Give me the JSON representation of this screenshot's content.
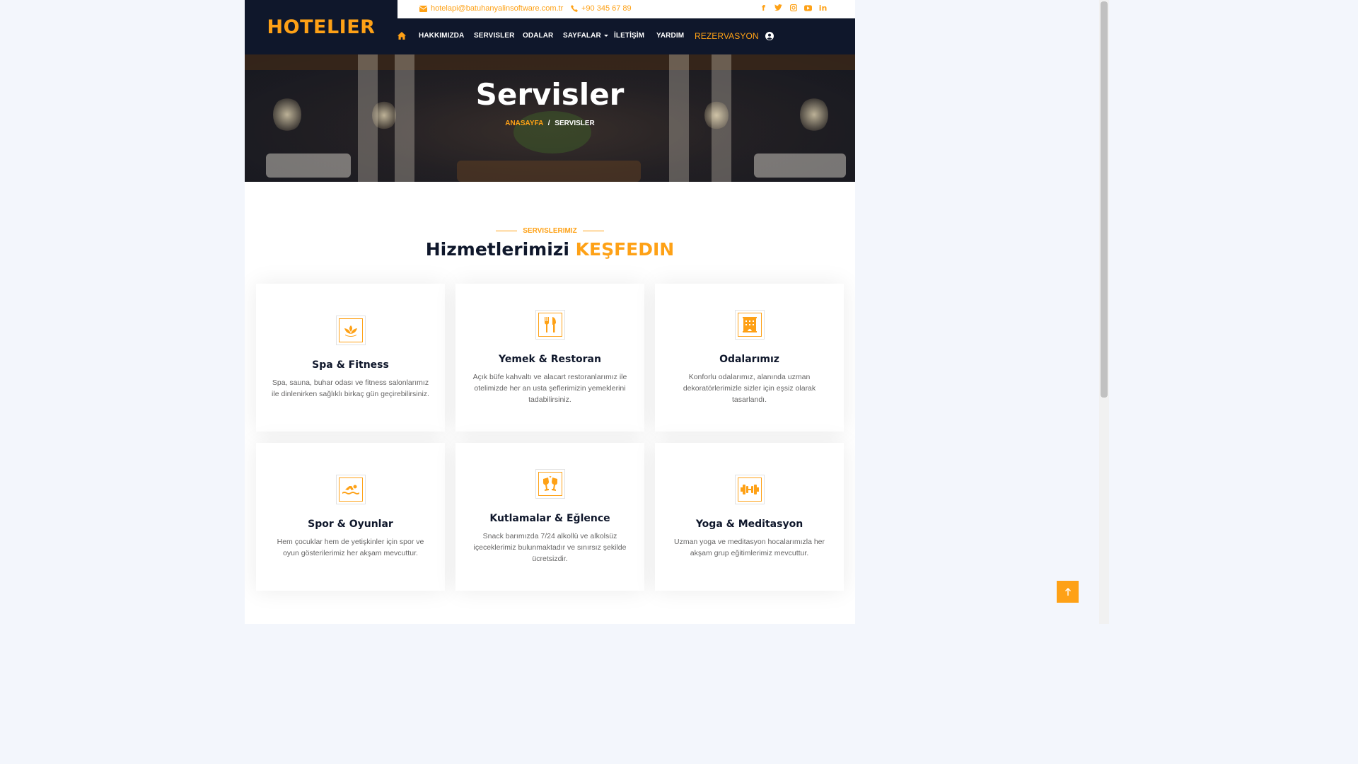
{
  "brand": {
    "name": "HOTELIER"
  },
  "topbar": {
    "email": "hotelapi@batuhanyalinsoftware.com.tr",
    "phone": "+90 345 67 89",
    "socials": [
      "facebook-icon",
      "twitter-icon",
      "instagram-icon",
      "youtube-icon",
      "linkedin-icon"
    ]
  },
  "nav": {
    "items": [
      "HAKKIMIZDA",
      "SERVISLER",
      "ODALAR",
      "SAYFALAR",
      "İLETİŞİM",
      "YARDIM"
    ],
    "cta": "REZERVASYON"
  },
  "hero": {
    "title": "Servisler",
    "breadcrumb_home": "ANASAYFA",
    "breadcrumb_sep": "/",
    "breadcrumb_current": "SERVISLER"
  },
  "section": {
    "eyebrow": "SERVISLERIMIZ",
    "title_main": "Hizmetlerimizi",
    "title_highlight": "KEŞFEDIN"
  },
  "services": [
    {
      "icon": "spa-icon",
      "title": "Spa & Fitness",
      "text": "Spa, sauna, buhar odası ve fitness salonlarımız ile dinlenirken sağlıklı birkaç gün geçirebilirsiniz."
    },
    {
      "icon": "utensils-icon",
      "title": "Yemek & Restoran",
      "text": "Açık büfe kahvaltı ve alacart restoranlarımız ile otelimizde her an usta şeflerimizin yemeklerini tadabilirsiniz."
    },
    {
      "icon": "hotel-icon",
      "title": "Odalarımız",
      "text": "Konforlu odalarımız, alanında uzman dekoratörlerimizle sizler için eşsiz olarak tasarlandı."
    },
    {
      "icon": "swimmer-icon",
      "title": "Spor & Oyunlar",
      "text": "Hem çocuklar hem de yetişkinler için spor ve oyun gösterilerimiz her akşam mevcuttur."
    },
    {
      "icon": "glass-cheers-icon",
      "title": "Kutlamalar & Eğlence",
      "text": "Snack barımızda 7/24 alkollü ve alkolsüz içeceklerimiz bulunmaktadır ve sınırsız şekilde ücretsizdir."
    },
    {
      "icon": "dumbbell-icon",
      "title": "Yoga & Meditasyon",
      "text": "Uzman yoga ve meditasyon hocalarımızla her akşam grup eğitimlerimiz mevcuttur."
    }
  ],
  "colors": {
    "accent": "#FEA116",
    "dark": "#0f172b"
  }
}
